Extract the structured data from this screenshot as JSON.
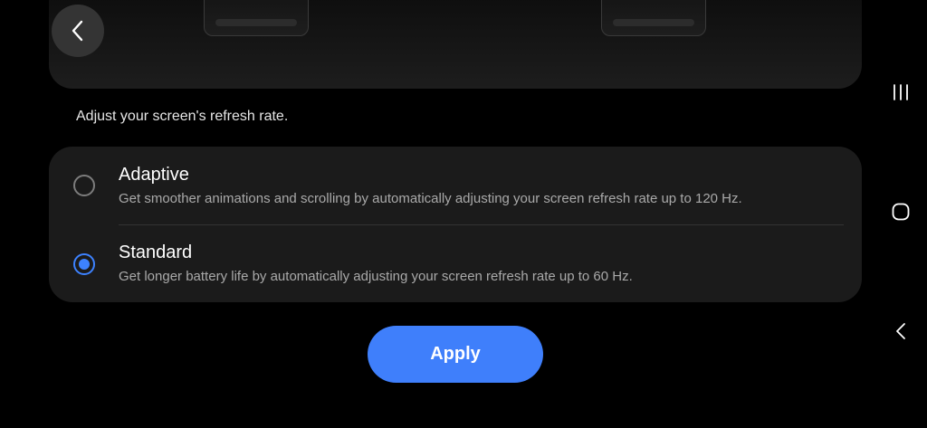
{
  "settings": {
    "description": "Adjust your screen's refresh rate.",
    "options": [
      {
        "title": "Adaptive",
        "subtitle": "Get smoother animations and scrolling by automatically adjusting your screen refresh rate up to 120 Hz.",
        "selected": false
      },
      {
        "title": "Standard",
        "subtitle": "Get longer battery life by automatically adjusting your screen refresh rate up to 60 Hz.",
        "selected": true
      }
    ],
    "apply_label": "Apply"
  },
  "icons": {
    "back": "chevron-left-icon",
    "recents": "recent-apps-icon",
    "home": "home-icon",
    "nav_back": "nav-back-icon"
  },
  "colors": {
    "accent": "#3f7ffb",
    "background": "#000000",
    "card": "#1b1b1b",
    "secondary_text": "#a9a9a9"
  }
}
